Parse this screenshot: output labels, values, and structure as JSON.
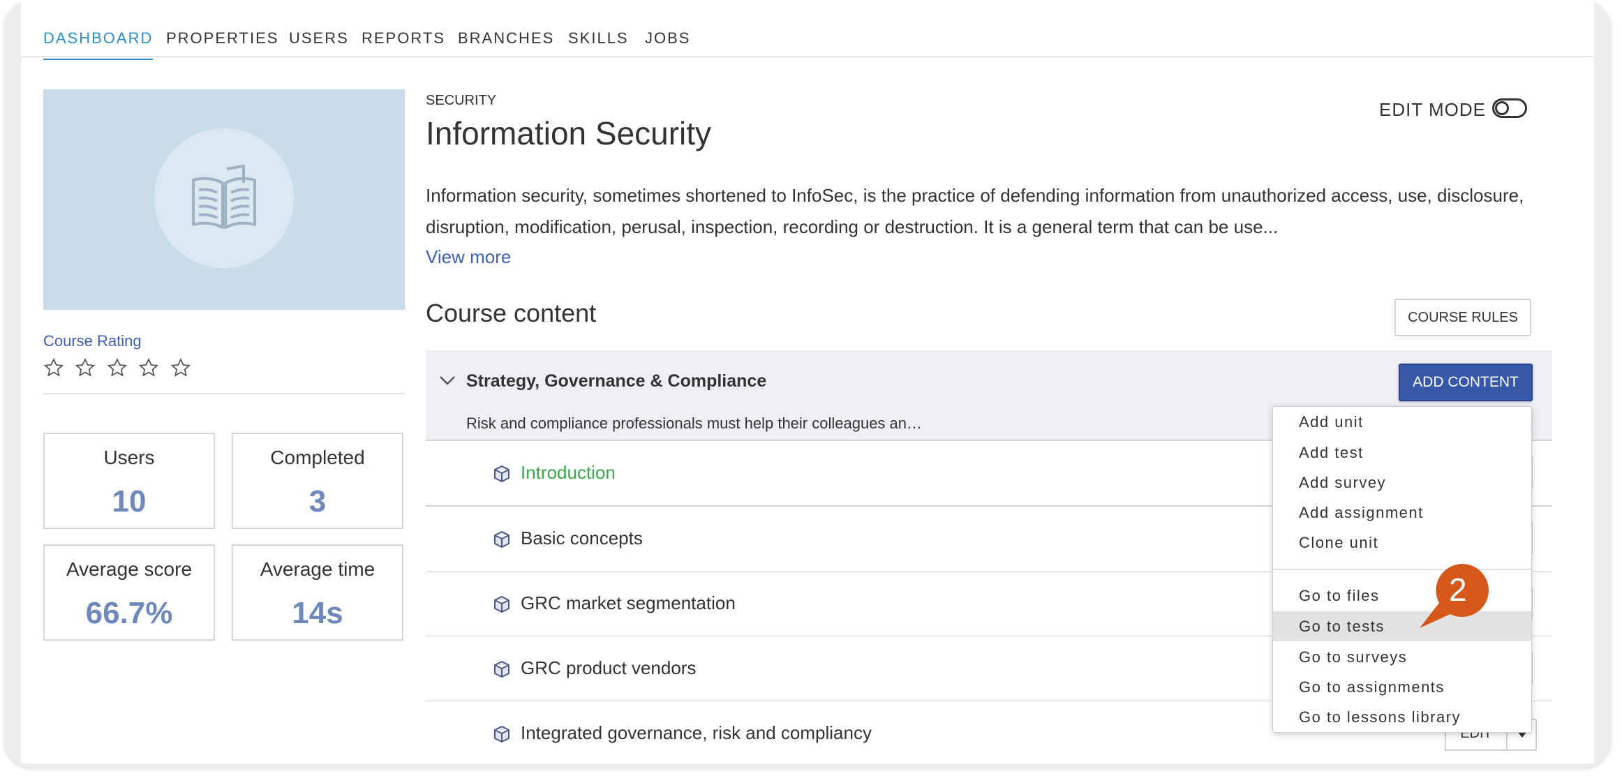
{
  "nav": {
    "items": [
      {
        "label": "DASHBOARD",
        "active": true
      },
      {
        "label": "PROPERTIES"
      },
      {
        "label": "USERS"
      },
      {
        "label": "REPORTS"
      },
      {
        "label": "BRANCHES"
      },
      {
        "label": "SKILLS"
      },
      {
        "label": "JOBS"
      }
    ]
  },
  "cover": {
    "icon": "open-book-icon",
    "color": "#c9dcea"
  },
  "rating": {
    "label": "Course Rating",
    "stars": 0,
    "max": 5
  },
  "stats": [
    {
      "label": "Users",
      "value": "10"
    },
    {
      "label": "Completed",
      "value": "3"
    },
    {
      "label": "Average score",
      "value": "66.7%"
    },
    {
      "label": "Average time",
      "value": "14s"
    }
  ],
  "course": {
    "category": "SECURITY",
    "title": "Information Security",
    "description": "Information security, sometimes shortened to InfoSec, is the practice of defending information from unauthorized access, use, disclosure, disruption, modification, perusal, inspection, recording or destruction. It is a general term that can be use...",
    "view_more": "View more"
  },
  "edit_mode": {
    "label": "EDIT MODE",
    "enabled": false
  },
  "content": {
    "heading": "Course content",
    "rules_button": "COURSE RULES",
    "section": {
      "title": "Strategy, Governance & Compliance",
      "description": "Risk and compliance professionals must help their colleagues an…",
      "add_button": "ADD CONTENT"
    },
    "units": [
      {
        "title": "Introduction",
        "status": "completed"
      },
      {
        "title": "Basic concepts"
      },
      {
        "title": "GRC market segmentation"
      },
      {
        "title": "GRC product vendors"
      },
      {
        "title": "Integrated governance, risk and compliancy",
        "button": "EDIT"
      }
    ]
  },
  "menu": {
    "group1": [
      "Add unit",
      "Add test",
      "Add survey",
      "Add assignment",
      "Clone unit"
    ],
    "group2": [
      "Go to files",
      "Go to tests",
      "Go to surveys",
      "Go to assignments",
      "Go to lessons library"
    ],
    "highlighted": "Go to tests"
  },
  "callout": {
    "number": "2",
    "color": "#d4581a"
  },
  "colors": {
    "accent": "#2f8cc8",
    "link": "#3f5fb0",
    "primary_button": "#3757a8",
    "stat_value": "#6f88bc",
    "completed": "#3aa84b"
  }
}
